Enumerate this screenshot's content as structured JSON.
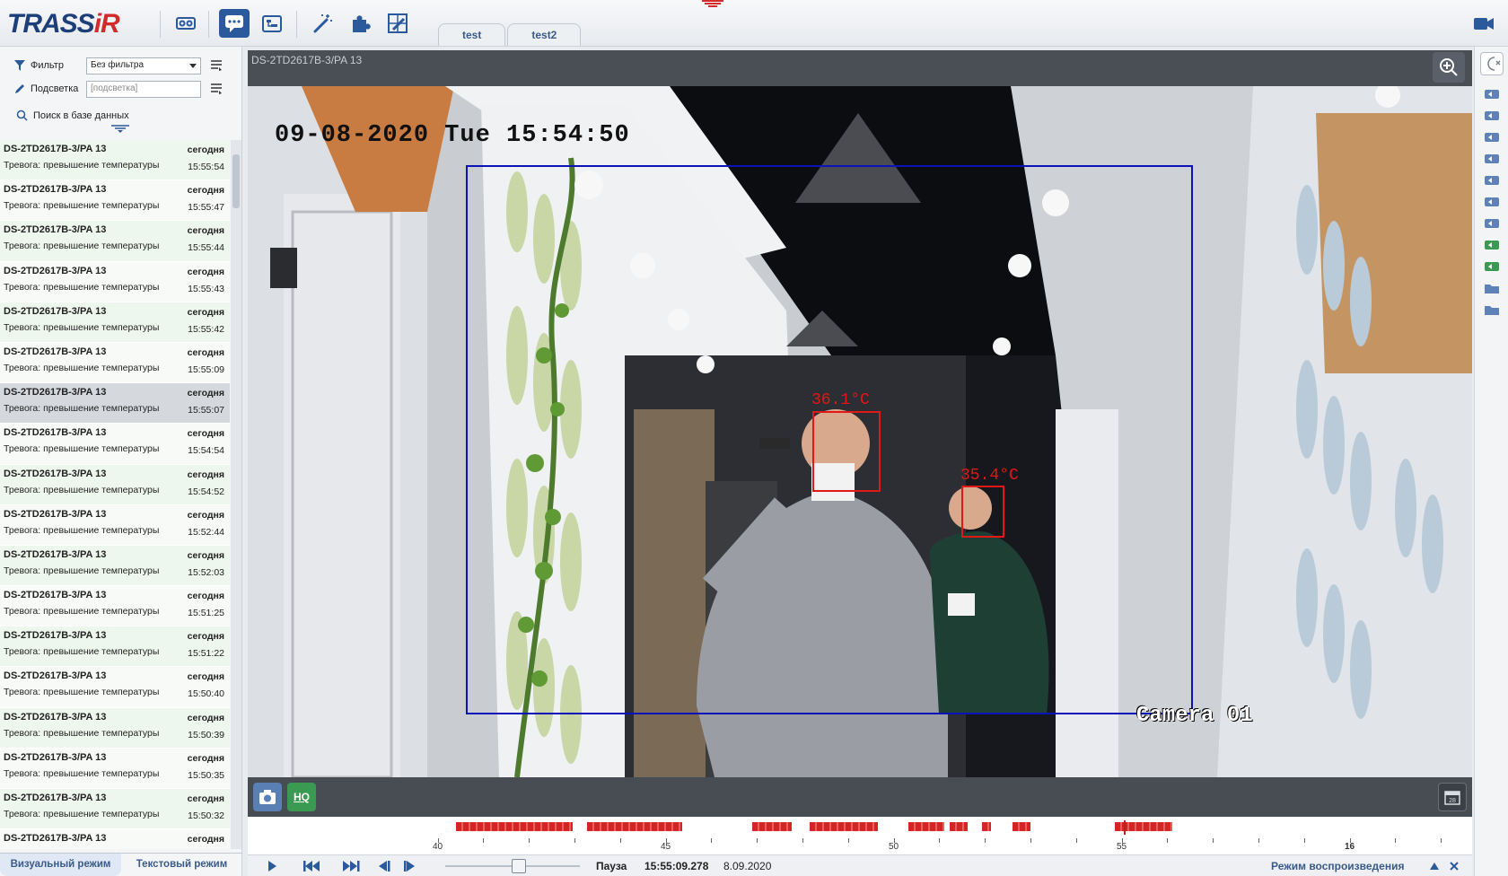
{
  "app": {
    "logo_main": "TRASS",
    "logo_accent": "iR"
  },
  "tabs": [
    {
      "label": "test"
    },
    {
      "label": "test2"
    }
  ],
  "filters": {
    "filter_label": "Фильтр",
    "filter_value": "Без фильтра",
    "highlight_label": "Подсветка",
    "highlight_placeholder": "[подсветка]",
    "search_db_label": "Поиск в базе данных"
  },
  "events": [
    {
      "camera": "DS-2TD2617B-3/PA 13",
      "message": "Тревога: превышение температуры",
      "day": "сегодня",
      "time": "15:55:54"
    },
    {
      "camera": "DS-2TD2617B-3/PA 13",
      "message": "Тревога: превышение температуры",
      "day": "сегодня",
      "time": "15:55:47"
    },
    {
      "camera": "DS-2TD2617B-3/PA 13",
      "message": "Тревога: превышение температуры",
      "day": "сегодня",
      "time": "15:55:44"
    },
    {
      "camera": "DS-2TD2617B-3/PA 13",
      "message": "Тревога: превышение температуры",
      "day": "сегодня",
      "time": "15:55:43"
    },
    {
      "camera": "DS-2TD2617B-3/PA 13",
      "message": "Тревога: превышение температуры",
      "day": "сегодня",
      "time": "15:55:42"
    },
    {
      "camera": "DS-2TD2617B-3/PA 13",
      "message": "Тревога: превышение температуры",
      "day": "сегодня",
      "time": "15:55:09"
    },
    {
      "camera": "DS-2TD2617B-3/PA 13",
      "message": "Тревога: превышение температуры",
      "day": "сегодня",
      "time": "15:55:07"
    },
    {
      "camera": "DS-2TD2617B-3/PA 13",
      "message": "Тревога: превышение температуры",
      "day": "сегодня",
      "time": "15:54:54"
    },
    {
      "camera": "DS-2TD2617B-3/PA 13",
      "message": "Тревога: превышение температуры",
      "day": "сегодня",
      "time": "15:54:52"
    },
    {
      "camera": "DS-2TD2617B-3/PA 13",
      "message": "Тревога: превышение температуры",
      "day": "сегодня",
      "time": "15:52:44"
    },
    {
      "camera": "DS-2TD2617B-3/PA 13",
      "message": "Тревога: превышение температуры",
      "day": "сегодня",
      "time": "15:52:03"
    },
    {
      "camera": "DS-2TD2617B-3/PA 13",
      "message": "Тревога: превышение температуры",
      "day": "сегодня",
      "time": "15:51:25"
    },
    {
      "camera": "DS-2TD2617B-3/PA 13",
      "message": "Тревога: превышение температуры",
      "day": "сегодня",
      "time": "15:51:22"
    },
    {
      "camera": "DS-2TD2617B-3/PA 13",
      "message": "Тревога: превышение температуры",
      "day": "сегодня",
      "time": "15:50:40"
    },
    {
      "camera": "DS-2TD2617B-3/PA 13",
      "message": "Тревога: превышение температуры",
      "day": "сегодня",
      "time": "15:50:39"
    },
    {
      "camera": "DS-2TD2617B-3/PA 13",
      "message": "Тревога: превышение температуры",
      "day": "сегодня",
      "time": "15:50:35"
    },
    {
      "camera": "DS-2TD2617B-3/PA 13",
      "message": "Тревога: превышение температуры",
      "day": "сегодня",
      "time": "15:50:32"
    },
    {
      "camera": "DS-2TD2617B-3/PA 13",
      "message": "",
      "day": "сегодня",
      "time": ""
    }
  ],
  "bottom_tabs": {
    "visual": "Визуальный режим",
    "text": "Текстовый режим"
  },
  "video": {
    "title": "DS-2TD2617B-3/PA 13",
    "osd_datetime": "09-08-2020 Tue 15:54:50",
    "osd_camera": "Camera 01",
    "temps": [
      "36.1°C",
      "35.4°C"
    ],
    "hq_label": "HQ",
    "calendar_day": "28"
  },
  "timeline": {
    "labels": [
      "40",
      "45",
      "50",
      "55",
      "16"
    ]
  },
  "controls": {
    "state": "Пауза",
    "time": "15:55:09.278",
    "date": "8.09.2020",
    "mode": "Режим воспроизведения"
  },
  "colors": {
    "accent": "#2a5a9c",
    "alarm": "#d42525",
    "roi": "#0b12b8"
  }
}
